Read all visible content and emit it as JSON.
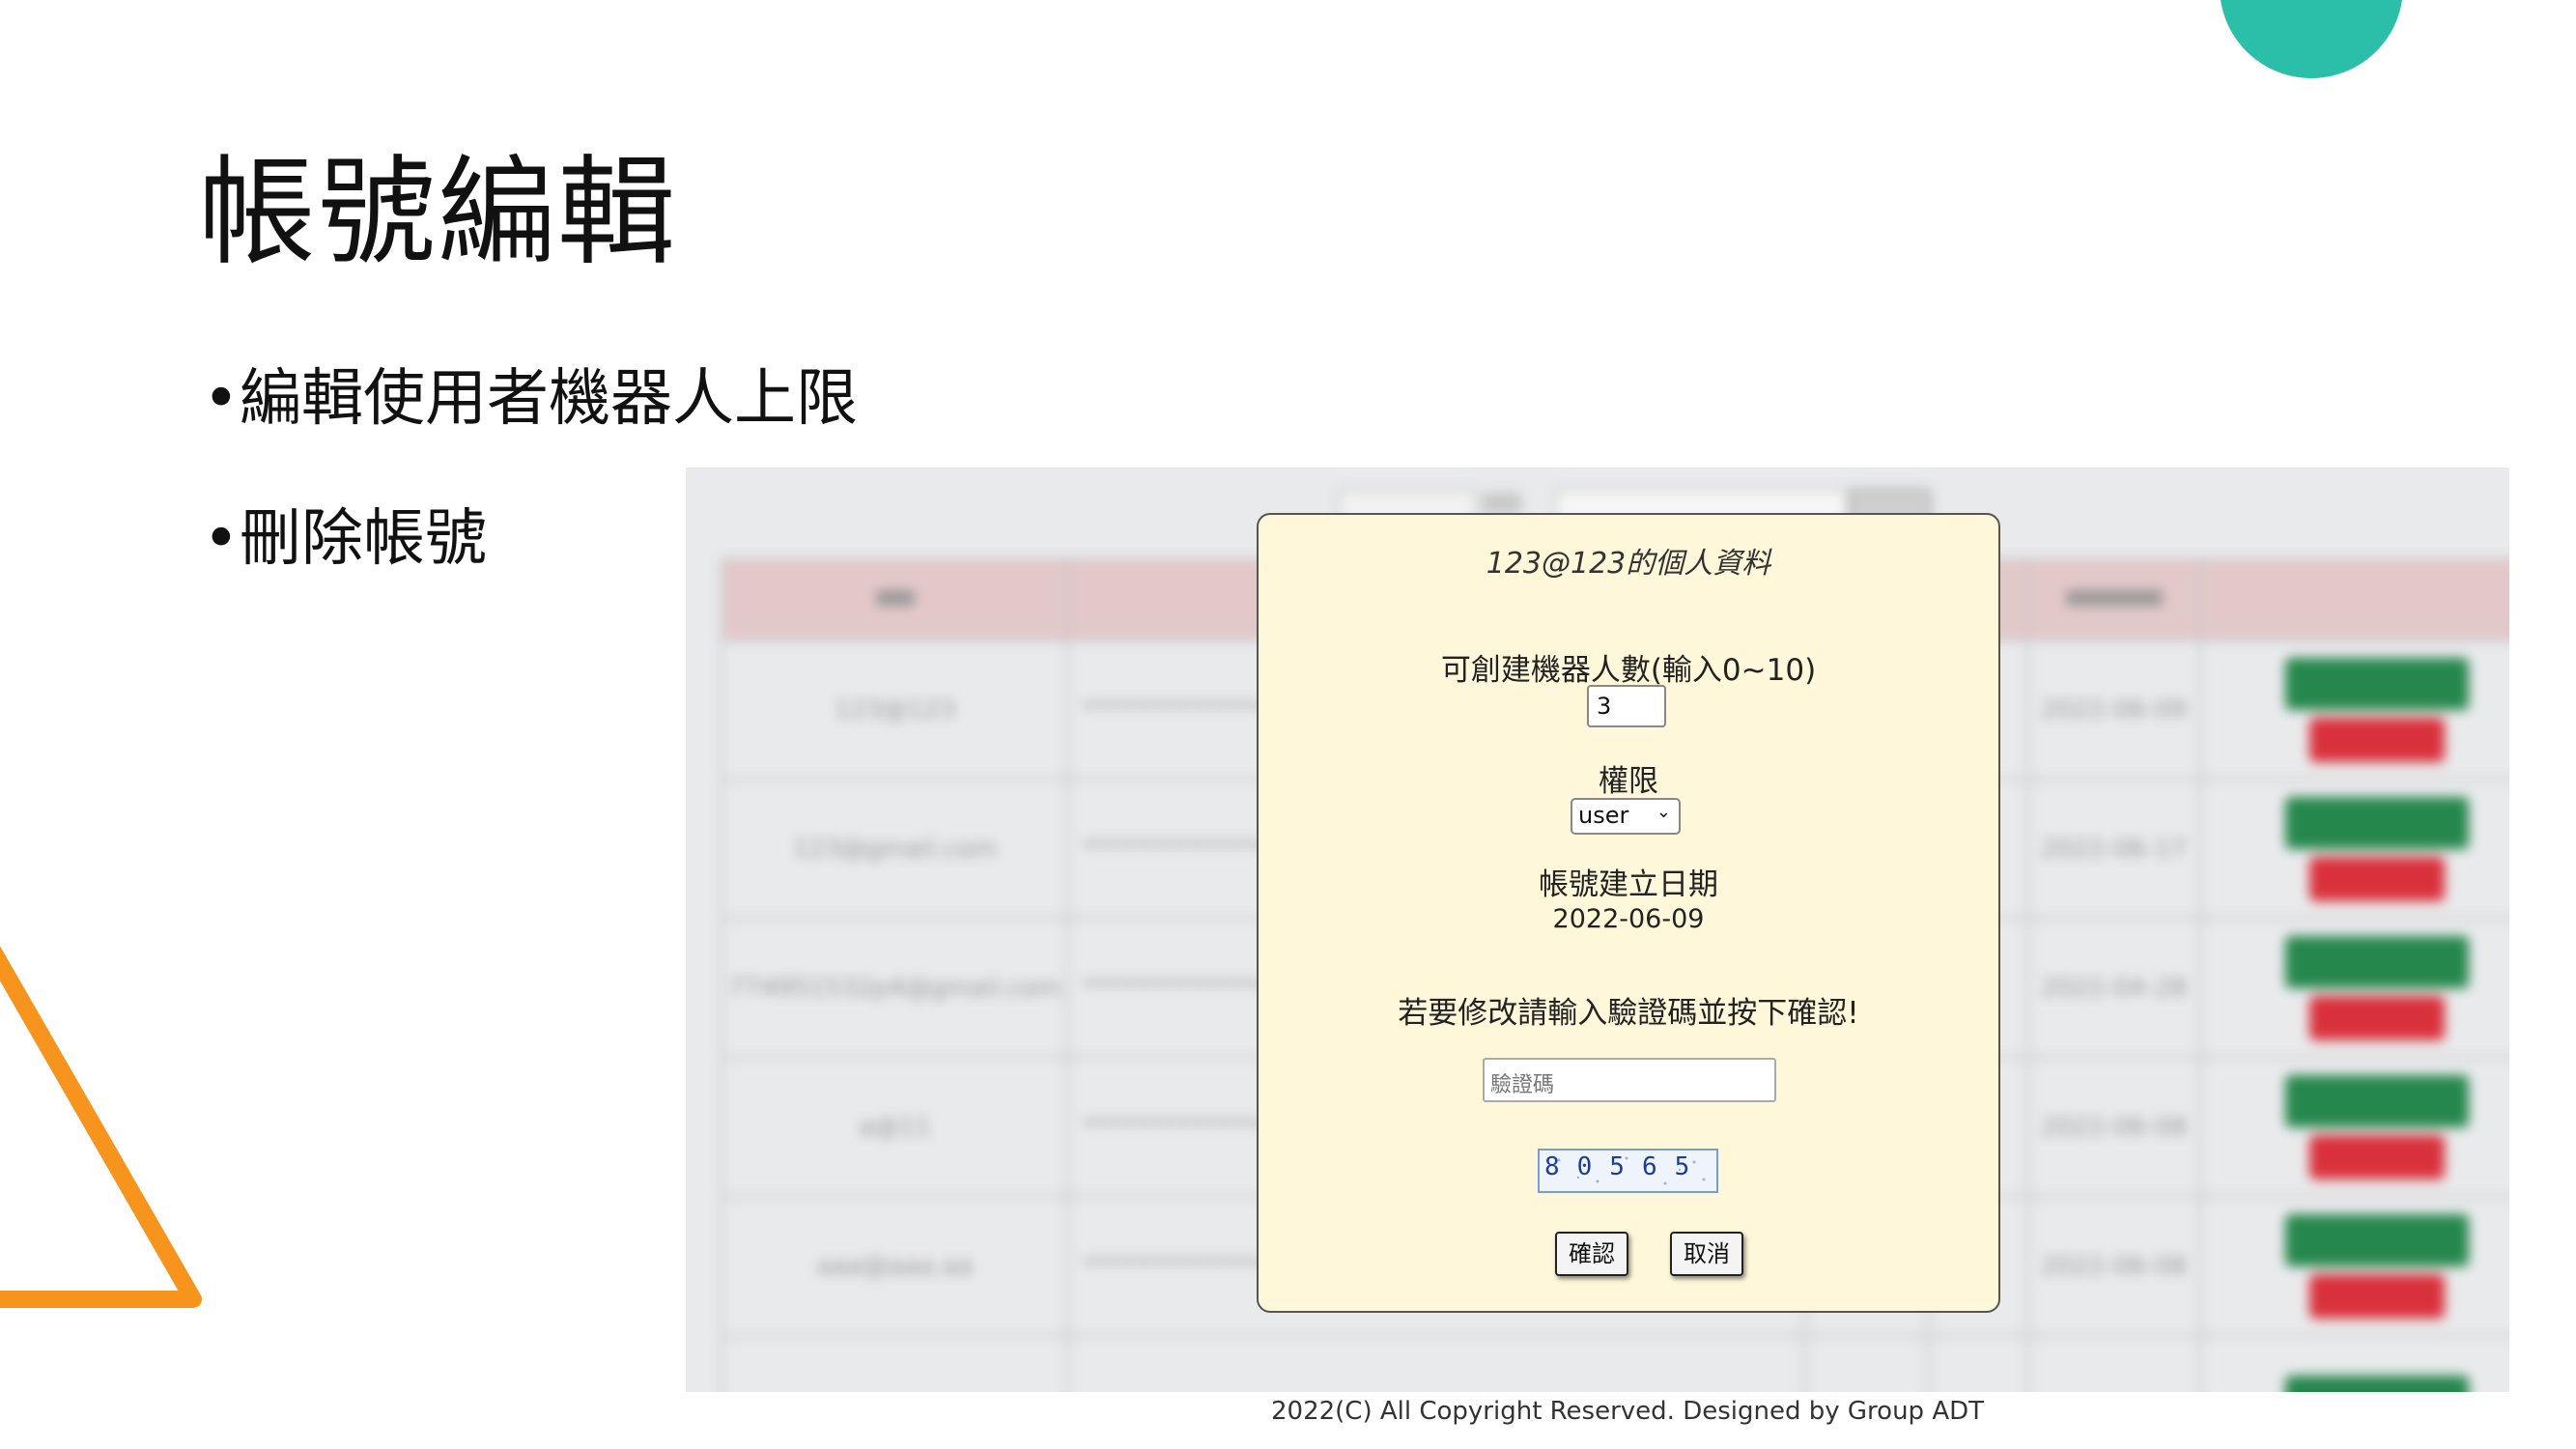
{
  "slide": {
    "title": "帳號編輯",
    "bullets": [
      "編輯使用者機器人上限",
      "刪除帳號"
    ]
  },
  "modal": {
    "title": "123@123的個人資料",
    "robots_label": "可創建機器人數(輸入0~10)",
    "robots_value": "3",
    "permission_label": "權限",
    "permission_value": "user",
    "created_label": "帳號建立日期",
    "created_value": "2022-06-09",
    "instruction": "若要修改請輸入驗證碼並按下確認!",
    "captcha_placeholder": "驗證碼",
    "captcha_text": "80565",
    "confirm_label": "確認",
    "cancel_label": "取消"
  },
  "table": {
    "rows": [
      {
        "account": "123@123",
        "password": "**************",
        "date": "2022-06-09"
      },
      {
        "account": "123@gmail.com",
        "password": "**************",
        "date": "2022-06-17"
      },
      {
        "account": "774951532p4@gmail.com",
        "password": "**************",
        "date": "2022-04-28"
      },
      {
        "account": "a@11",
        "password": "**************",
        "date": "2022-06-08"
      },
      {
        "account": "aaa@aaa.aa",
        "password": "**************",
        "date": "2022-06-08"
      }
    ]
  },
  "footer": "2022(C) All Copyright Reserved. Designed by Group ADT",
  "colors": {
    "teal": "#2bbfaa",
    "orange": "#f7941d",
    "modal_bg": "#fef7da",
    "edit_button": "#26874c",
    "delete_button": "#d9313b"
  }
}
